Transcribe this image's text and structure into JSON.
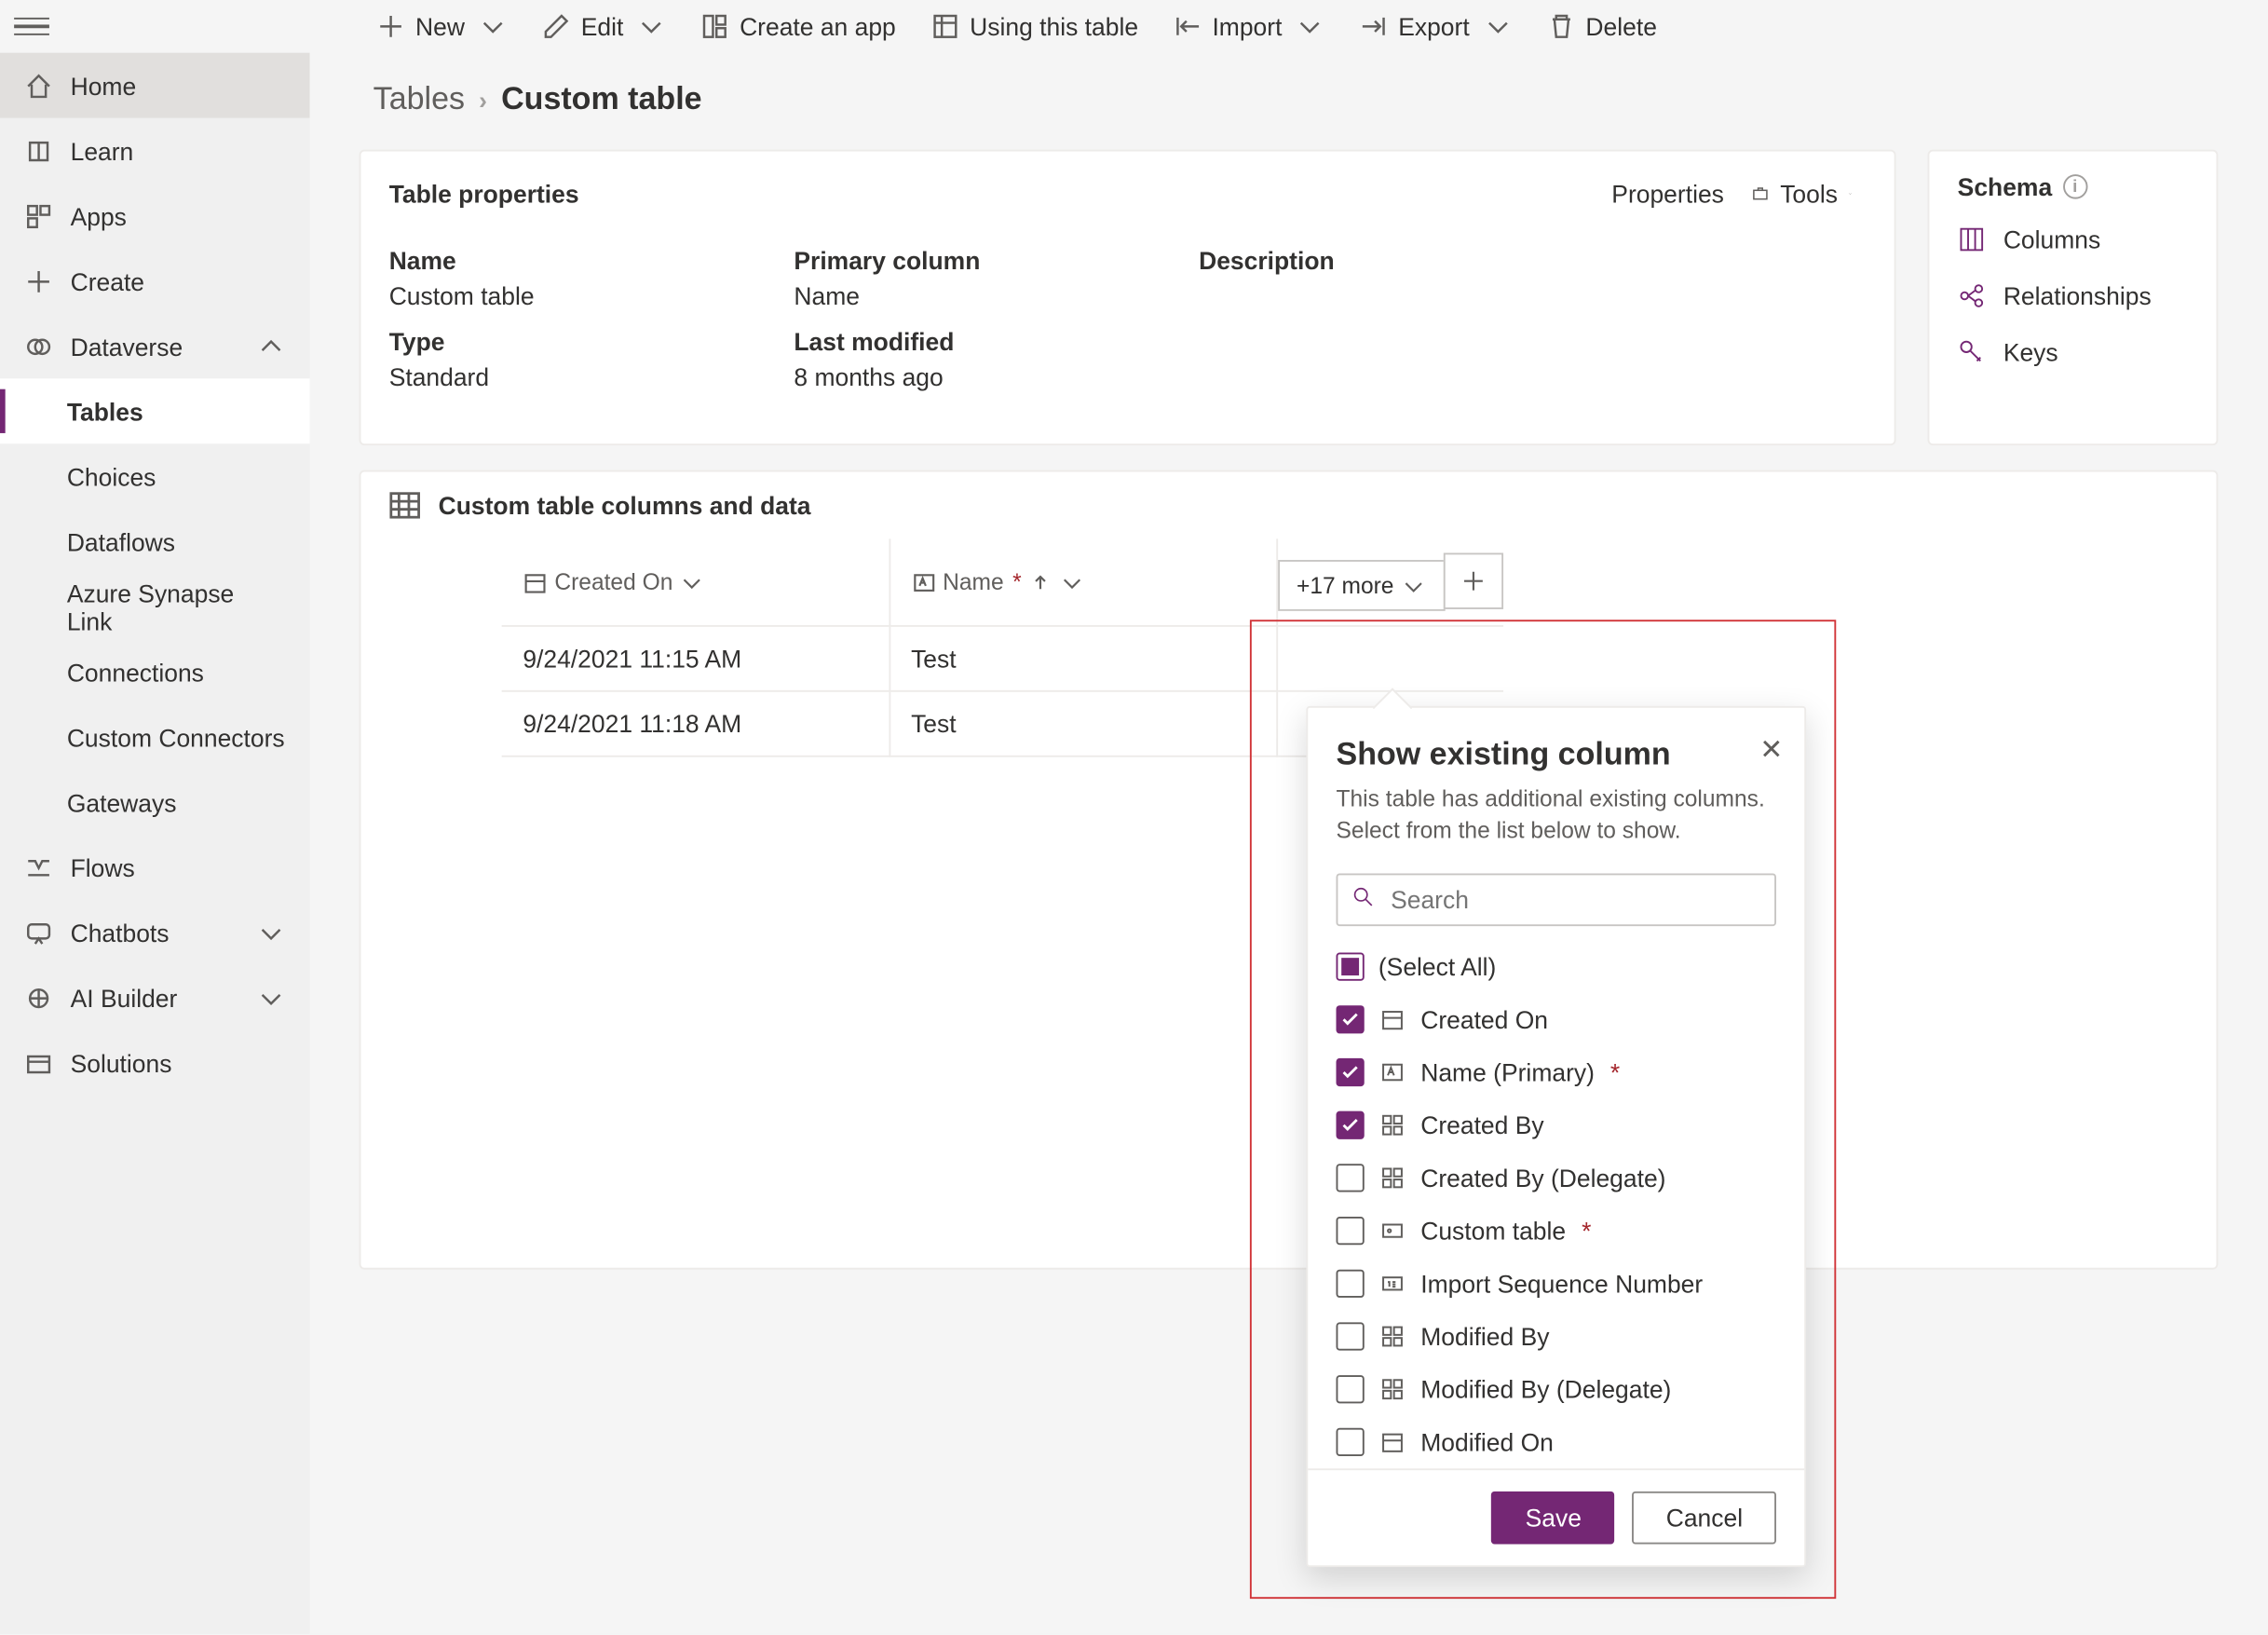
{
  "cmd": {
    "new": "New",
    "edit": "Edit",
    "create_app": "Create an app",
    "using_table": "Using this table",
    "import": "Import",
    "export": "Export",
    "delete": "Delete"
  },
  "nav": {
    "home": "Home",
    "learn": "Learn",
    "apps": "Apps",
    "create": "Create",
    "dataverse": "Dataverse",
    "tables": "Tables",
    "choices": "Choices",
    "dataflows": "Dataflows",
    "synapse": "Azure Synapse Link",
    "connections": "Connections",
    "custom_connectors": "Custom Connectors",
    "gateways": "Gateways",
    "flows": "Flows",
    "chatbots": "Chatbots",
    "ai_builder": "AI Builder",
    "solutions": "Solutions"
  },
  "breadcrumb": {
    "root": "Tables",
    "current": "Custom table"
  },
  "props": {
    "card_title": "Table properties",
    "btn_properties": "Properties",
    "btn_tools": "Tools",
    "name_label": "Name",
    "name_value": "Custom table",
    "type_label": "Type",
    "type_value": "Standard",
    "primary_label": "Primary column",
    "primary_value": "Name",
    "modified_label": "Last modified",
    "modified_value": "8 months ago",
    "description_label": "Description",
    "description_value": ""
  },
  "schema": {
    "title": "Schema",
    "columns": "Columns",
    "relationships": "Relationships",
    "keys": "Keys"
  },
  "grid": {
    "title": "Custom table columns and data",
    "col_created": "Created On",
    "col_name": "Name",
    "more": "+17 more",
    "rows": [
      {
        "created": "9/24/2021 11:15 AM",
        "name": "Test"
      },
      {
        "created": "9/24/2021 11:18 AM",
        "name": "Test"
      }
    ]
  },
  "flyout": {
    "title": "Show existing column",
    "subtitle": "This table has additional existing columns. Select from the list below to show.",
    "search_placeholder": "Search",
    "save": "Save",
    "cancel": "Cancel",
    "items": [
      {
        "label": "(Select All)",
        "state": "mixed",
        "icon": ""
      },
      {
        "label": "Created On",
        "state": "checked",
        "icon": "date"
      },
      {
        "label": "Name (Primary)",
        "state": "checked",
        "icon": "text",
        "required": true
      },
      {
        "label": "Created By",
        "state": "checked",
        "icon": "lookup"
      },
      {
        "label": "Created By (Delegate)",
        "state": "unchecked",
        "icon": "lookup"
      },
      {
        "label": "Custom table",
        "state": "unchecked",
        "icon": "key",
        "required": true
      },
      {
        "label": "Import Sequence Number",
        "state": "unchecked",
        "icon": "number"
      },
      {
        "label": "Modified By",
        "state": "unchecked",
        "icon": "lookup"
      },
      {
        "label": "Modified By (Delegate)",
        "state": "unchecked",
        "icon": "lookup"
      },
      {
        "label": "Modified On",
        "state": "unchecked",
        "icon": "date"
      }
    ]
  }
}
